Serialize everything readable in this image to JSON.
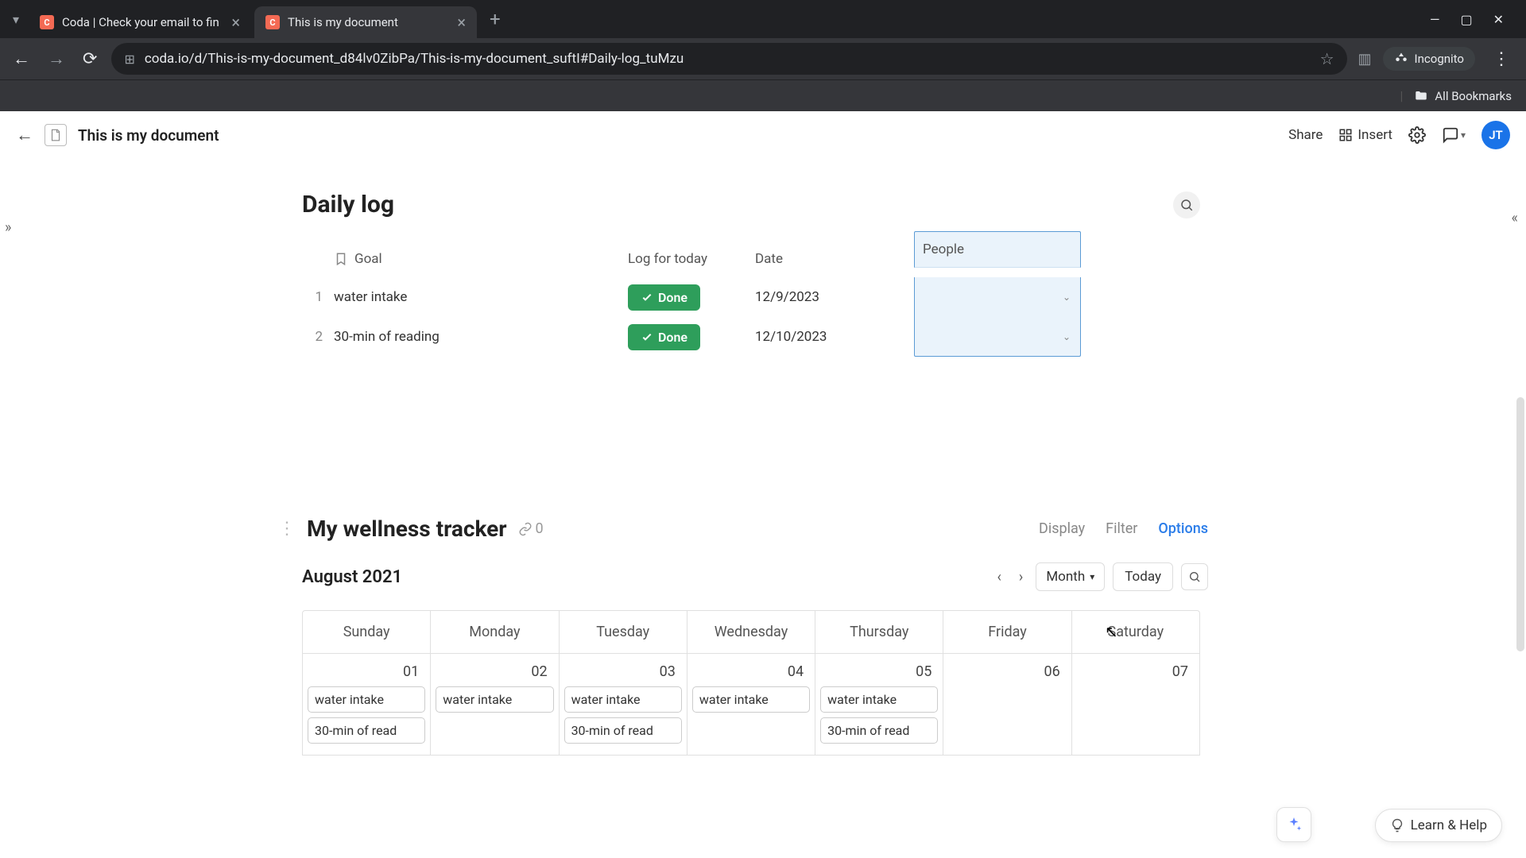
{
  "browser": {
    "tabs": [
      {
        "title": "Coda | Check your email to fin"
      },
      {
        "title": "This is my document"
      }
    ],
    "url": "coda.io/d/This-is-my-document_d84lv0ZibPa/This-is-my-document_suftI#Daily-log_tuMzu",
    "incognito_label": "Incognito",
    "bookmarks_label": "All Bookmarks"
  },
  "app": {
    "doc_title": "This is my document",
    "share": "Share",
    "insert": "Insert",
    "avatar": "JT"
  },
  "daily_log": {
    "title": "Daily log",
    "columns": {
      "goal": "Goal",
      "log": "Log for today",
      "date": "Date",
      "people": "People"
    },
    "done_label": "Done",
    "rows": [
      {
        "n": "1",
        "goal": "water intake",
        "date": "12/9/2023"
      },
      {
        "n": "2",
        "goal": "30-min of reading",
        "date": "12/10/2023"
      }
    ]
  },
  "tracker": {
    "title": "My wellness tracker",
    "link_count": "0",
    "tabs": {
      "display": "Display",
      "filter": "Filter",
      "options": "Options"
    },
    "month_label": "August 2021",
    "view_dropdown": "Month",
    "today": "Today",
    "weekdays": [
      "Sunday",
      "Monday",
      "Tuesday",
      "Wednesday",
      "Thursday",
      "Friday",
      "Saturday"
    ],
    "days": [
      {
        "num": "01",
        "events": [
          "water intake",
          "30-min of read"
        ]
      },
      {
        "num": "02",
        "events": [
          "water intake"
        ]
      },
      {
        "num": "03",
        "events": [
          "water intake",
          "30-min of read"
        ]
      },
      {
        "num": "04",
        "events": [
          "water intake"
        ]
      },
      {
        "num": "05",
        "events": [
          "water intake",
          "30-min of read"
        ]
      },
      {
        "num": "06",
        "events": []
      },
      {
        "num": "07",
        "events": []
      }
    ]
  },
  "footer": {
    "learn_help": "Learn & Help"
  }
}
